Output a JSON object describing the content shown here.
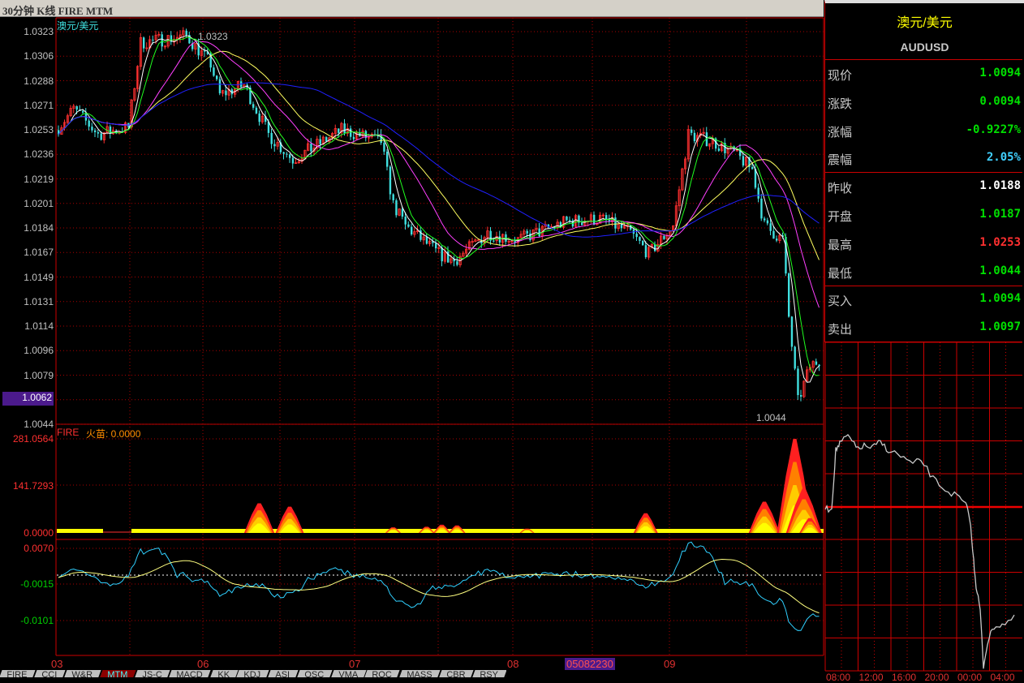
{
  "title": "30分钟 K线 FIRE MTM",
  "instrument_label": "澳元/美元",
  "price_axis": [
    "1.0323",
    "1.0306",
    "1.0288",
    "1.0271",
    "1.0253",
    "1.0236",
    "1.0219",
    "1.0201",
    "1.0184",
    "1.0167",
    "1.0149",
    "1.0131",
    "1.0114",
    "1.0096",
    "1.0079",
    "1.0062",
    "1.0044"
  ],
  "price_cursor": "1.0062",
  "high_marker": "1.0323",
  "low_marker": "1.0044",
  "fire": {
    "label": "FIRE",
    "sub": "火苗: 0.0000",
    "axis": [
      "281.0564",
      "141.7293",
      "0.0000"
    ],
    "max": 281.0564,
    "spikes": [
      [
        66,
        85
      ],
      [
        76,
        75
      ],
      [
        110,
        12
      ],
      [
        121,
        14
      ],
      [
        126,
        20
      ],
      [
        131,
        18
      ],
      [
        154,
        8
      ],
      [
        193,
        55
      ],
      [
        232,
        90
      ],
      [
        242,
        281
      ],
      [
        245,
        130
      ],
      [
        247,
        40
      ]
    ]
  },
  "mtm": {
    "axis": [
      "0.0070",
      "-0.0015",
      "-0.0101"
    ],
    "period": 12,
    "ma": 20
  },
  "x_axis": [
    "03",
    "06",
    "07",
    "08",
    "09"
  ],
  "x_cursor": "05082230",
  "tabs": [
    "FIRE",
    "CCI",
    "W&R",
    "MTM",
    "JS-C",
    "MACD",
    "KK",
    "KDJ",
    "ASI",
    "OSC",
    "VMA",
    "ROC",
    "MASS",
    "CBR",
    "RSY"
  ],
  "active_tab": "MTM",
  "colors": {
    "up": "#ff3030",
    "down": "#40e0e0",
    "green": "#00e000",
    "red": "#ff3030",
    "cyan": "#40d0ff"
  },
  "chart_data": {
    "type": "candlestick",
    "bars": 251,
    "ylim": [
      1.0044,
      1.0323
    ],
    "key_closes": [
      [
        0,
        1.0255
      ],
      [
        5,
        1.0268
      ],
      [
        13,
        1.025
      ],
      [
        23,
        1.0255
      ],
      [
        27,
        1.0315
      ],
      [
        42,
        1.032
      ],
      [
        50,
        1.03
      ],
      [
        53,
        1.0278
      ],
      [
        61,
        1.0285
      ],
      [
        69,
        1.025
      ],
      [
        77,
        1.0232
      ],
      [
        87,
        1.0245
      ],
      [
        93,
        1.0253
      ],
      [
        106,
        1.0245
      ],
      [
        110,
        1.02
      ],
      [
        114,
        1.0185
      ],
      [
        125,
        1.0165
      ],
      [
        130,
        1.016
      ],
      [
        141,
        1.018
      ],
      [
        151,
        1.0175
      ],
      [
        167,
        1.0188
      ],
      [
        178,
        1.019
      ],
      [
        188,
        1.018
      ],
      [
        194,
        1.0165
      ],
      [
        202,
        1.0185
      ],
      [
        207,
        1.025
      ],
      [
        215,
        1.0245
      ],
      [
        223,
        1.0235
      ],
      [
        228,
        1.0225
      ],
      [
        232,
        1.0185
      ],
      [
        238,
        1.0175
      ],
      [
        240,
        1.012
      ],
      [
        243,
        1.006
      ],
      [
        247,
        1.0085
      ],
      [
        250,
        1.009
      ]
    ]
  },
  "quote": {
    "name": "澳元/美元",
    "code": "AUDUSD",
    "rows": [
      {
        "k": "现价",
        "v": "1.0094",
        "c": "#00e000"
      },
      {
        "k": "涨跌",
        "v": "0.0094",
        "c": "#00e000"
      },
      {
        "k": "涨幅",
        "v": "-0.9227%",
        "c": "#00e000"
      },
      {
        "k": "震幅",
        "v": "2.05%",
        "c": "#40d0ff"
      },
      {
        "k": "昨收",
        "v": "1.0188",
        "c": "#ffffff"
      },
      {
        "k": "开盘",
        "v": "1.0187",
        "c": "#00e000"
      },
      {
        "k": "最高",
        "v": "1.0253",
        "c": "#ff3030"
      },
      {
        "k": "最低",
        "v": "1.0044",
        "c": "#00e000"
      },
      {
        "k": "买入",
        "v": "1.0094",
        "c": "#00e000"
      },
      {
        "k": "卖出",
        "v": "1.0097",
        "c": "#00e000"
      }
    ]
  },
  "mini_times": [
    "08:00",
    "12:00",
    "16:00",
    "20:00",
    "00:00",
    "04:00"
  ]
}
